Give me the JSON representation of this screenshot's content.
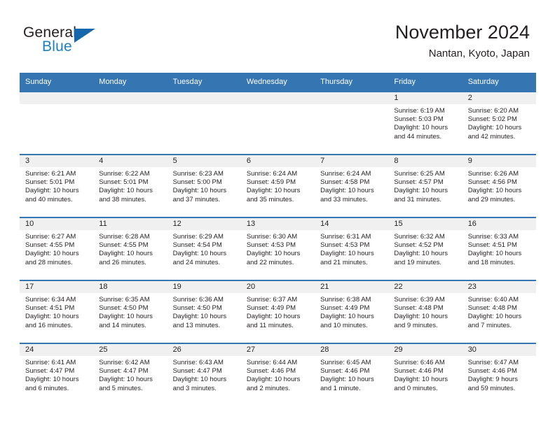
{
  "brand": {
    "name_top": "General",
    "name_bottom": "Blue",
    "logo_icon": "triangle-flag-icon",
    "color_blue": "#1b7fc4",
    "color_triangle": "#1566ab"
  },
  "header": {
    "title": "November 2024",
    "subtitle": "Nantan, Kyoto, Japan",
    "header_bg": "#3575b2",
    "daynum_bg": "#f0f0f0"
  },
  "weekdays": [
    "Sunday",
    "Monday",
    "Tuesday",
    "Wednesday",
    "Thursday",
    "Friday",
    "Saturday"
  ],
  "weeks": [
    [
      {
        "day": "",
        "lines": []
      },
      {
        "day": "",
        "lines": []
      },
      {
        "day": "",
        "lines": []
      },
      {
        "day": "",
        "lines": []
      },
      {
        "day": "",
        "lines": []
      },
      {
        "day": "1",
        "lines": [
          "Sunrise: 6:19 AM",
          "Sunset: 5:03 PM",
          "Daylight: 10 hours",
          "and 44 minutes."
        ]
      },
      {
        "day": "2",
        "lines": [
          "Sunrise: 6:20 AM",
          "Sunset: 5:02 PM",
          "Daylight: 10 hours",
          "and 42 minutes."
        ]
      }
    ],
    [
      {
        "day": "3",
        "lines": [
          "Sunrise: 6:21 AM",
          "Sunset: 5:01 PM",
          "Daylight: 10 hours",
          "and 40 minutes."
        ]
      },
      {
        "day": "4",
        "lines": [
          "Sunrise: 6:22 AM",
          "Sunset: 5:01 PM",
          "Daylight: 10 hours",
          "and 38 minutes."
        ]
      },
      {
        "day": "5",
        "lines": [
          "Sunrise: 6:23 AM",
          "Sunset: 5:00 PM",
          "Daylight: 10 hours",
          "and 37 minutes."
        ]
      },
      {
        "day": "6",
        "lines": [
          "Sunrise: 6:24 AM",
          "Sunset: 4:59 PM",
          "Daylight: 10 hours",
          "and 35 minutes."
        ]
      },
      {
        "day": "7",
        "lines": [
          "Sunrise: 6:24 AM",
          "Sunset: 4:58 PM",
          "Daylight: 10 hours",
          "and 33 minutes."
        ]
      },
      {
        "day": "8",
        "lines": [
          "Sunrise: 6:25 AM",
          "Sunset: 4:57 PM",
          "Daylight: 10 hours",
          "and 31 minutes."
        ]
      },
      {
        "day": "9",
        "lines": [
          "Sunrise: 6:26 AM",
          "Sunset: 4:56 PM",
          "Daylight: 10 hours",
          "and 29 minutes."
        ]
      }
    ],
    [
      {
        "day": "10",
        "lines": [
          "Sunrise: 6:27 AM",
          "Sunset: 4:55 PM",
          "Daylight: 10 hours",
          "and 28 minutes."
        ]
      },
      {
        "day": "11",
        "lines": [
          "Sunrise: 6:28 AM",
          "Sunset: 4:55 PM",
          "Daylight: 10 hours",
          "and 26 minutes."
        ]
      },
      {
        "day": "12",
        "lines": [
          "Sunrise: 6:29 AM",
          "Sunset: 4:54 PM",
          "Daylight: 10 hours",
          "and 24 minutes."
        ]
      },
      {
        "day": "13",
        "lines": [
          "Sunrise: 6:30 AM",
          "Sunset: 4:53 PM",
          "Daylight: 10 hours",
          "and 22 minutes."
        ]
      },
      {
        "day": "14",
        "lines": [
          "Sunrise: 6:31 AM",
          "Sunset: 4:53 PM",
          "Daylight: 10 hours",
          "and 21 minutes."
        ]
      },
      {
        "day": "15",
        "lines": [
          "Sunrise: 6:32 AM",
          "Sunset: 4:52 PM",
          "Daylight: 10 hours",
          "and 19 minutes."
        ]
      },
      {
        "day": "16",
        "lines": [
          "Sunrise: 6:33 AM",
          "Sunset: 4:51 PM",
          "Daylight: 10 hours",
          "and 18 minutes."
        ]
      }
    ],
    [
      {
        "day": "17",
        "lines": [
          "Sunrise: 6:34 AM",
          "Sunset: 4:51 PM",
          "Daylight: 10 hours",
          "and 16 minutes."
        ]
      },
      {
        "day": "18",
        "lines": [
          "Sunrise: 6:35 AM",
          "Sunset: 4:50 PM",
          "Daylight: 10 hours",
          "and 14 minutes."
        ]
      },
      {
        "day": "19",
        "lines": [
          "Sunrise: 6:36 AM",
          "Sunset: 4:50 PM",
          "Daylight: 10 hours",
          "and 13 minutes."
        ]
      },
      {
        "day": "20",
        "lines": [
          "Sunrise: 6:37 AM",
          "Sunset: 4:49 PM",
          "Daylight: 10 hours",
          "and 11 minutes."
        ]
      },
      {
        "day": "21",
        "lines": [
          "Sunrise: 6:38 AM",
          "Sunset: 4:49 PM",
          "Daylight: 10 hours",
          "and 10 minutes."
        ]
      },
      {
        "day": "22",
        "lines": [
          "Sunrise: 6:39 AM",
          "Sunset: 4:48 PM",
          "Daylight: 10 hours",
          "and 9 minutes."
        ]
      },
      {
        "day": "23",
        "lines": [
          "Sunrise: 6:40 AM",
          "Sunset: 4:48 PM",
          "Daylight: 10 hours",
          "and 7 minutes."
        ]
      }
    ],
    [
      {
        "day": "24",
        "lines": [
          "Sunrise: 6:41 AM",
          "Sunset: 4:47 PM",
          "Daylight: 10 hours",
          "and 6 minutes."
        ]
      },
      {
        "day": "25",
        "lines": [
          "Sunrise: 6:42 AM",
          "Sunset: 4:47 PM",
          "Daylight: 10 hours",
          "and 5 minutes."
        ]
      },
      {
        "day": "26",
        "lines": [
          "Sunrise: 6:43 AM",
          "Sunset: 4:47 PM",
          "Daylight: 10 hours",
          "and 3 minutes."
        ]
      },
      {
        "day": "27",
        "lines": [
          "Sunrise: 6:44 AM",
          "Sunset: 4:46 PM",
          "Daylight: 10 hours",
          "and 2 minutes."
        ]
      },
      {
        "day": "28",
        "lines": [
          "Sunrise: 6:45 AM",
          "Sunset: 4:46 PM",
          "Daylight: 10 hours",
          "and 1 minute."
        ]
      },
      {
        "day": "29",
        "lines": [
          "Sunrise: 6:46 AM",
          "Sunset: 4:46 PM",
          "Daylight: 10 hours",
          "and 0 minutes."
        ]
      },
      {
        "day": "30",
        "lines": [
          "Sunrise: 6:47 AM",
          "Sunset: 4:46 PM",
          "Daylight: 9 hours",
          "and 59 minutes."
        ]
      }
    ]
  ]
}
